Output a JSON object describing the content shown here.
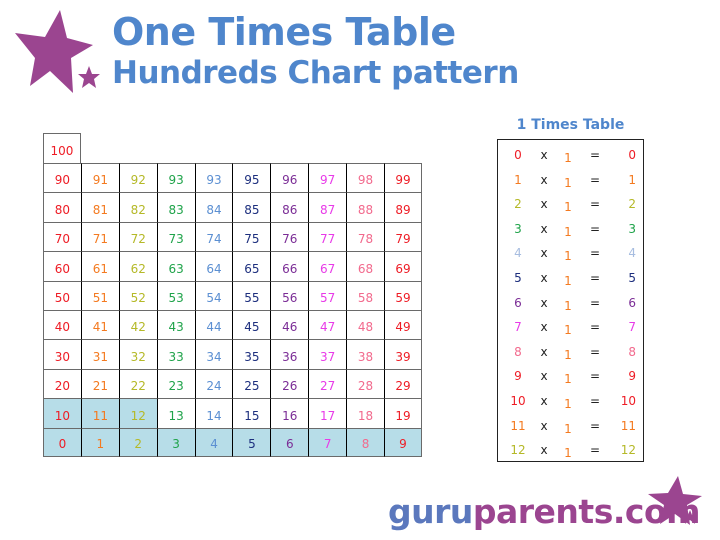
{
  "header": {
    "title_line1": "One Times Table",
    "title_line2": "Hundreds Chart pattern",
    "title_color": "#4f86cc",
    "decoration": "purple-stars-icon",
    "star_color": "#9b4590"
  },
  "hundreds_chart": {
    "column_colors": [
      "#ee1c25",
      "#f47a20",
      "#b5b928",
      "#1fa34a",
      "#5b8fd2",
      "#1d2f7e",
      "#7b2d96",
      "#e83ae8",
      "#f26a8d",
      "#ee1c25"
    ],
    "highlight_color": "#b7dde8",
    "top_cell": "100",
    "rows": [
      {
        "cells": [
          "90",
          "91",
          "92",
          "93",
          "93",
          "95",
          "96",
          "97",
          "98",
          "99"
        ],
        "highlight": [
          false,
          false,
          false,
          false,
          false,
          false,
          false,
          false,
          false,
          false
        ]
      },
      {
        "cells": [
          "80",
          "81",
          "82",
          "83",
          "84",
          "85",
          "86",
          "87",
          "88",
          "89"
        ],
        "highlight": [
          false,
          false,
          false,
          false,
          false,
          false,
          false,
          false,
          false,
          false
        ]
      },
      {
        "cells": [
          "70",
          "71",
          "72",
          "73",
          "74",
          "75",
          "76",
          "77",
          "78",
          "79"
        ],
        "highlight": [
          false,
          false,
          false,
          false,
          false,
          false,
          false,
          false,
          false,
          false
        ]
      },
      {
        "cells": [
          "60",
          "61",
          "62",
          "63",
          "64",
          "65",
          "66",
          "67",
          "68",
          "69"
        ],
        "highlight": [
          false,
          false,
          false,
          false,
          false,
          false,
          false,
          false,
          false,
          false
        ]
      },
      {
        "cells": [
          "50",
          "51",
          "52",
          "53",
          "54",
          "55",
          "56",
          "57",
          "58",
          "59"
        ],
        "highlight": [
          false,
          false,
          false,
          false,
          false,
          false,
          false,
          false,
          false,
          false
        ]
      },
      {
        "cells": [
          "40",
          "41",
          "42",
          "43",
          "44",
          "45",
          "46",
          "47",
          "48",
          "49"
        ],
        "highlight": [
          false,
          false,
          false,
          false,
          false,
          false,
          false,
          false,
          false,
          false
        ]
      },
      {
        "cells": [
          "30",
          "31",
          "32",
          "33",
          "34",
          "35",
          "36",
          "37",
          "38",
          "39"
        ],
        "highlight": [
          false,
          false,
          false,
          false,
          false,
          false,
          false,
          false,
          false,
          false
        ]
      },
      {
        "cells": [
          "20",
          "21",
          "22",
          "23",
          "24",
          "25",
          "26",
          "27",
          "28",
          "29"
        ],
        "highlight": [
          false,
          false,
          false,
          false,
          false,
          false,
          false,
          false,
          false,
          false
        ]
      },
      {
        "cells": [
          "10",
          "11",
          "12",
          "13",
          "14",
          "15",
          "16",
          "17",
          "18",
          "19"
        ],
        "highlight": [
          true,
          true,
          true,
          false,
          false,
          false,
          false,
          false,
          false,
          false
        ]
      },
      {
        "cells": [
          "0",
          "1",
          "2",
          "3",
          "4",
          "5",
          "6",
          "7",
          "8",
          "9"
        ],
        "highlight": [
          true,
          true,
          true,
          true,
          true,
          true,
          true,
          true,
          true,
          true
        ]
      }
    ]
  },
  "times_table": {
    "title": "1 Times Table",
    "operator": "x",
    "multiplier": "1",
    "equals": "=",
    "row_colors": [
      "#ee1c25",
      "#f47a20",
      "#b5b928",
      "#1fa34a",
      "#a7bde0",
      "#1d2f7e",
      "#7b2d96",
      "#e83ae8",
      "#f26a8d",
      "#ee1c25",
      "#ee1c25",
      "#f47a20",
      "#b5b928"
    ],
    "rows": [
      {
        "a": "0",
        "result": "0"
      },
      {
        "a": "1",
        "result": "1"
      },
      {
        "a": "2",
        "result": "2"
      },
      {
        "a": "3",
        "result": "3"
      },
      {
        "a": "4",
        "result": "4"
      },
      {
        "a": "5",
        "result": "5"
      },
      {
        "a": "6",
        "result": "6"
      },
      {
        "a": "7",
        "result": "7"
      },
      {
        "a": "8",
        "result": "8"
      },
      {
        "a": "9",
        "result": "9"
      },
      {
        "a": "10",
        "result": "10"
      },
      {
        "a": "11",
        "result": "11"
      },
      {
        "a": "12",
        "result": "12"
      }
    ]
  },
  "footer": {
    "logo_part1": "guru",
    "logo_part2": "parents.com",
    "logo_color1": "#5b78bd",
    "logo_color2": "#9b4590"
  }
}
